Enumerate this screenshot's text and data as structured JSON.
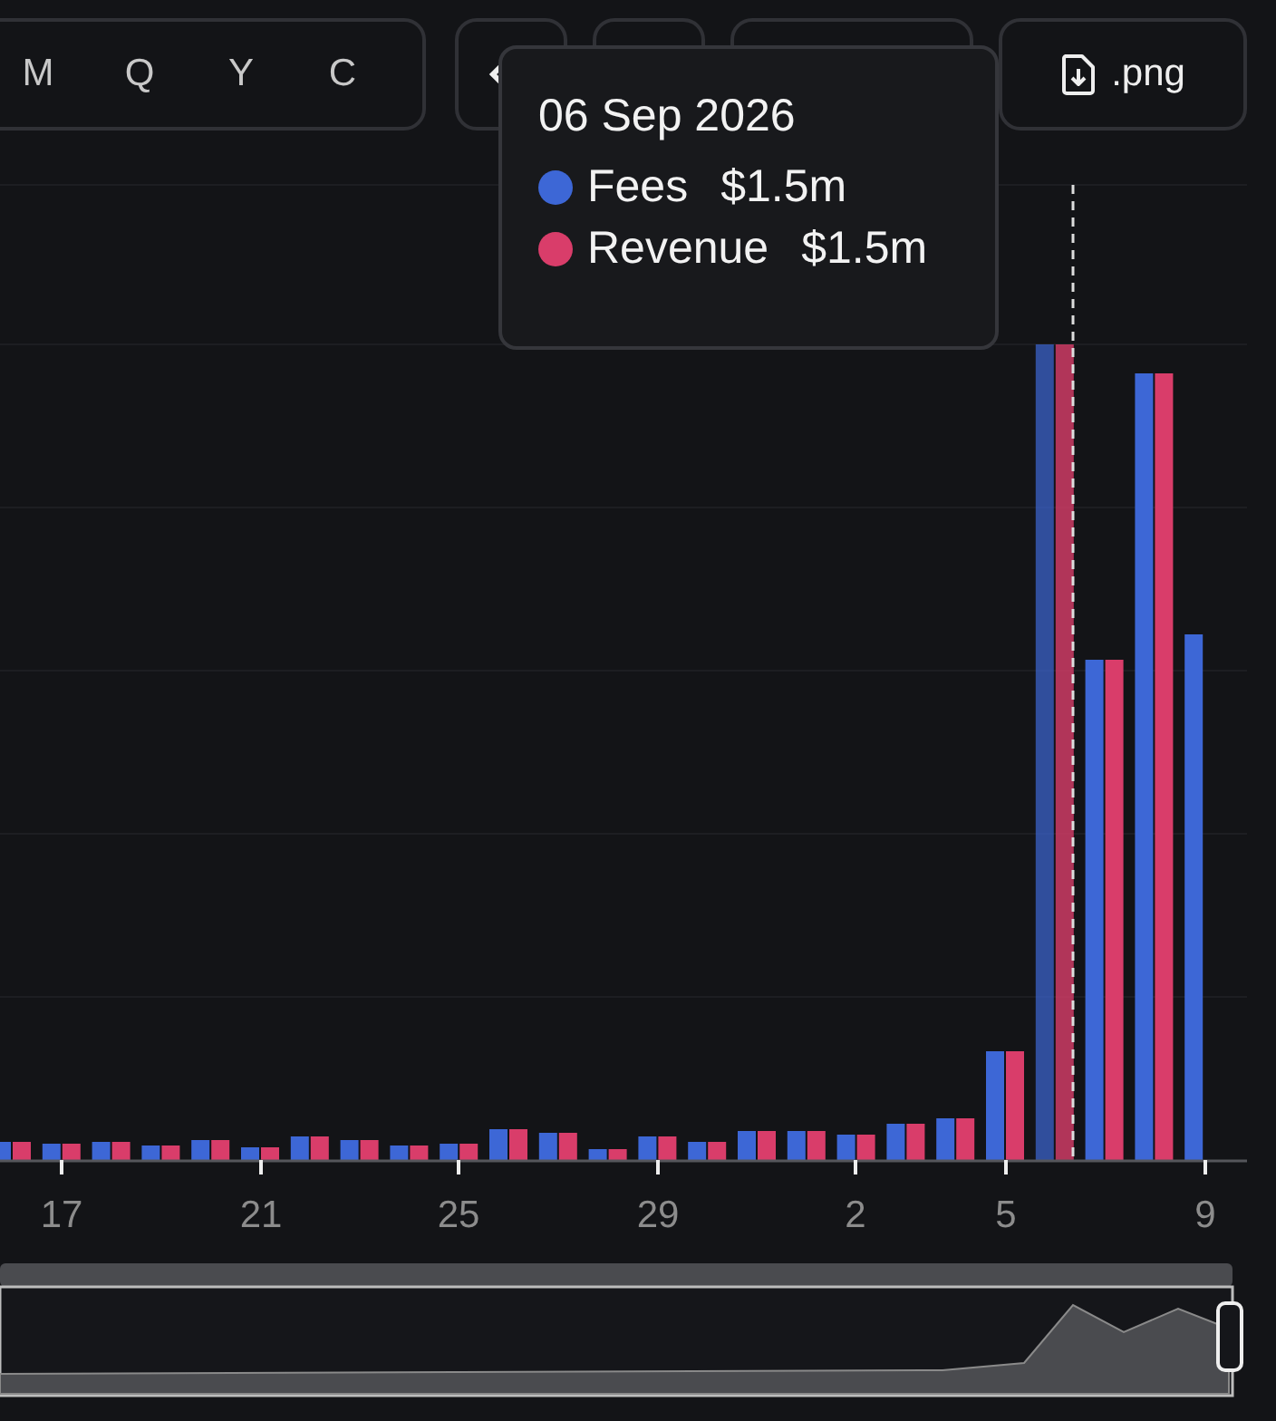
{
  "period_buttons": [
    "M",
    "Q",
    "Y",
    "C"
  ],
  "export_button": {
    "label": ".png"
  },
  "tooltip": {
    "date": "06 Sep 2026",
    "items": [
      {
        "name": "Fees",
        "value": "$1.5m",
        "color": "#3d67d6"
      },
      {
        "name": "Revenue",
        "value": "$1.5m",
        "color": "#d93d6a"
      }
    ]
  },
  "x_axis_labels": [
    "17",
    "21",
    "25",
    "29",
    "2",
    "5",
    "9"
  ]
}
